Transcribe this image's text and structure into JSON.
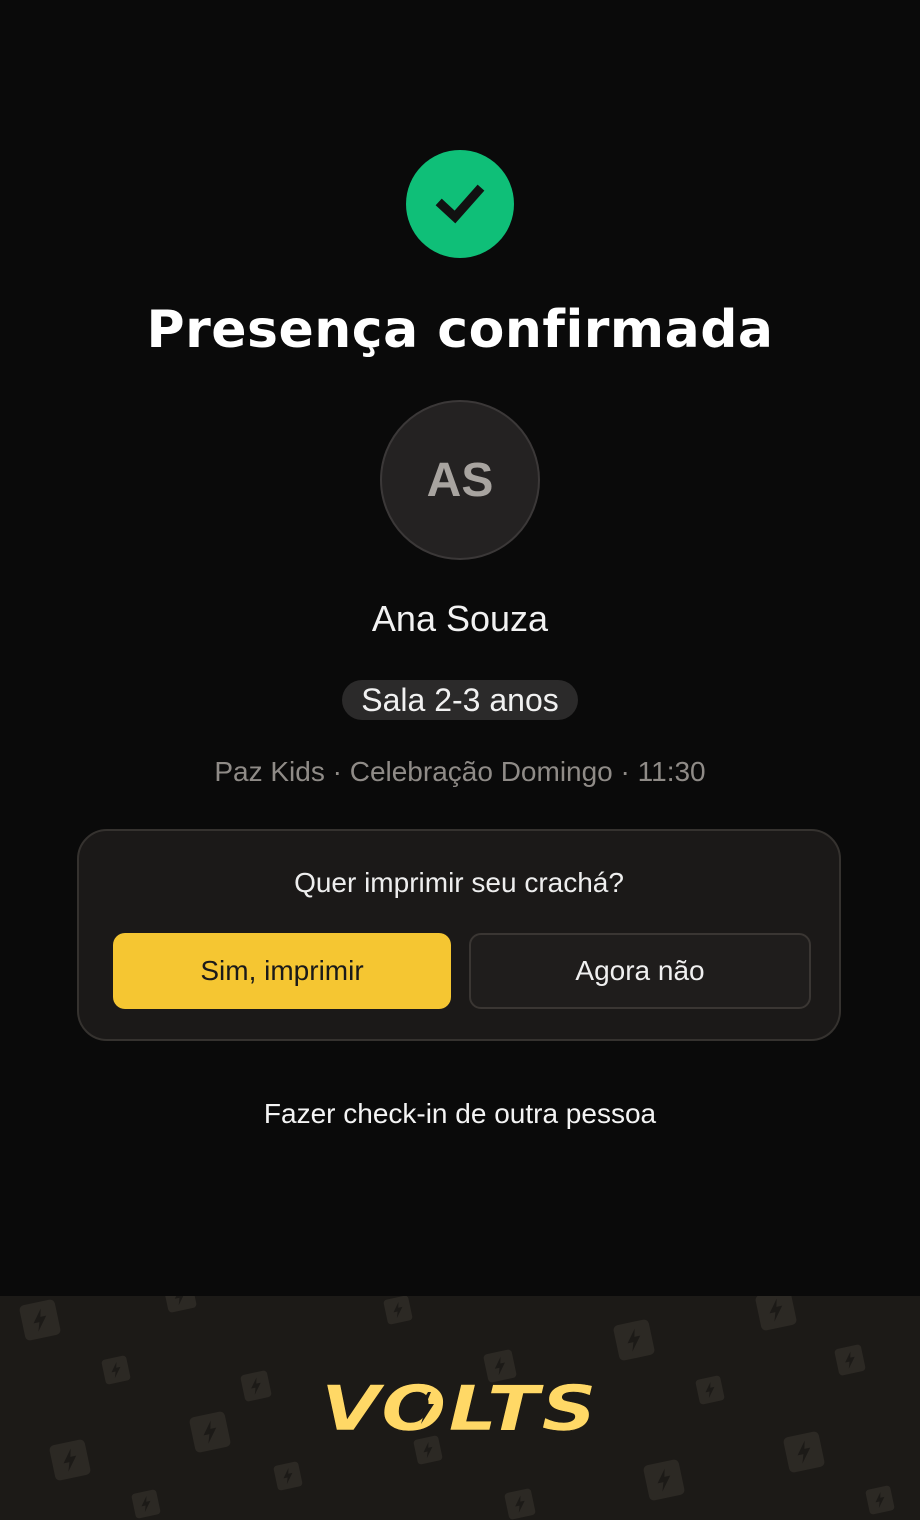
{
  "confirmation": {
    "title": "Presença confirmada",
    "check_icon": "checkmark-icon",
    "success_color": "#0fbf78"
  },
  "person": {
    "initials": "AS",
    "name": "Ana Souza",
    "room": "Sala 2-3 anos",
    "meta": "Paz Kids · Celebração Domingo · 11:30"
  },
  "print_prompt": {
    "question": "Quer imprimir seu crachá?",
    "yes_label": "Sim, imprimir",
    "no_label": "Agora não",
    "accent_color": "#f5c632"
  },
  "other_checkin": {
    "label": "Fazer check-in de outra pessoa"
  },
  "footer": {
    "logo_text": "VOLTS",
    "pattern_icon": "lightning-bolt-icon",
    "logo_color": "#ffd866"
  }
}
